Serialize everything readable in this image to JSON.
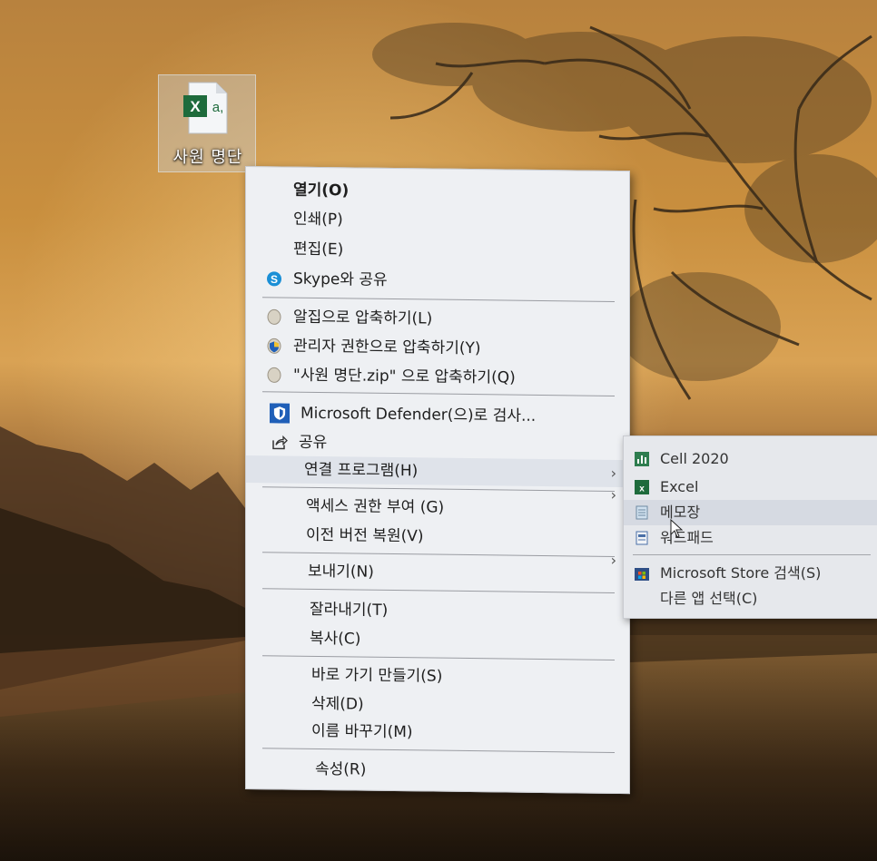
{
  "desktop": {
    "file_icon_name": "excel-file-icon",
    "file_label": "사원 명단",
    "excel_x": "X",
    "excel_a": "a,"
  },
  "context_menu": {
    "items": [
      {
        "label": "열기(O)",
        "bold": true,
        "icon": ""
      },
      {
        "label": "인쇄(P)",
        "icon": ""
      },
      {
        "label": "편집(E)",
        "icon": ""
      },
      {
        "label": "Skype와 공유",
        "icon": "skype-icon"
      },
      {
        "label": "알집으로 압축하기(L)",
        "icon": "alzip-icon"
      },
      {
        "label": "관리자 권한으로 압축하기(Y)",
        "icon": "admin-shield-icon"
      },
      {
        "label": "\"사원 명단.zip\" 으로 압축하기(Q)",
        "icon": "alzip-icon"
      },
      {
        "label": "Microsoft Defender(으)로 검사...",
        "icon": "defender-icon"
      },
      {
        "label": "공유",
        "icon": "share-icon"
      },
      {
        "label": "연결 프로그램(H)",
        "icon": ""
      },
      {
        "label": "액세스 권한 부여 (G)",
        "icon": ""
      },
      {
        "label": "이전 버전 복원(V)",
        "icon": ""
      },
      {
        "label": "보내기(N)",
        "icon": ""
      },
      {
        "label": "잘라내기(T)",
        "icon": ""
      },
      {
        "label": "복사(C)",
        "icon": ""
      },
      {
        "label": "바로 가기 만들기(S)",
        "icon": ""
      },
      {
        "label": "삭제(D)",
        "icon": ""
      },
      {
        "label": "이름 바꾸기(M)",
        "icon": ""
      },
      {
        "label": "속성(R)",
        "icon": ""
      }
    ],
    "submenu_arrow": "›"
  },
  "open_with_submenu": {
    "items": [
      {
        "label": "Cell 2020",
        "icon": "cell-icon"
      },
      {
        "label": "Excel",
        "icon": "excel-icon"
      },
      {
        "label": "메모장",
        "icon": "notepad-icon"
      },
      {
        "label": "워드패드",
        "icon": "wordpad-icon"
      },
      {
        "label": "Microsoft Store 검색(S)",
        "icon": "store-icon"
      },
      {
        "label": "다른 앱 선택(C)",
        "icon": ""
      }
    ]
  },
  "colors": {
    "menu_bg": "#eef0f3",
    "excel_green": "#1e6b3c",
    "skype_blue": "#1a8fd6",
    "defender_blue": "#1f5fb8"
  }
}
